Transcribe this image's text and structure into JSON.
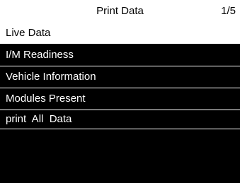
{
  "header": {
    "title": "Print Data",
    "page": "1/5"
  },
  "menu": {
    "items": [
      {
        "label": "Live Data",
        "selected": true
      },
      {
        "label": "I/M Readiness",
        "selected": false
      },
      {
        "label": "Vehicle Information",
        "selected": false
      },
      {
        "label": "Modules Present",
        "selected": false
      },
      {
        "label": "print  All  Data",
        "selected": false
      }
    ]
  },
  "colors": {
    "background": "#000000",
    "foreground": "#ffffff",
    "selected_background": "#ffffff",
    "selected_foreground": "#000000"
  }
}
